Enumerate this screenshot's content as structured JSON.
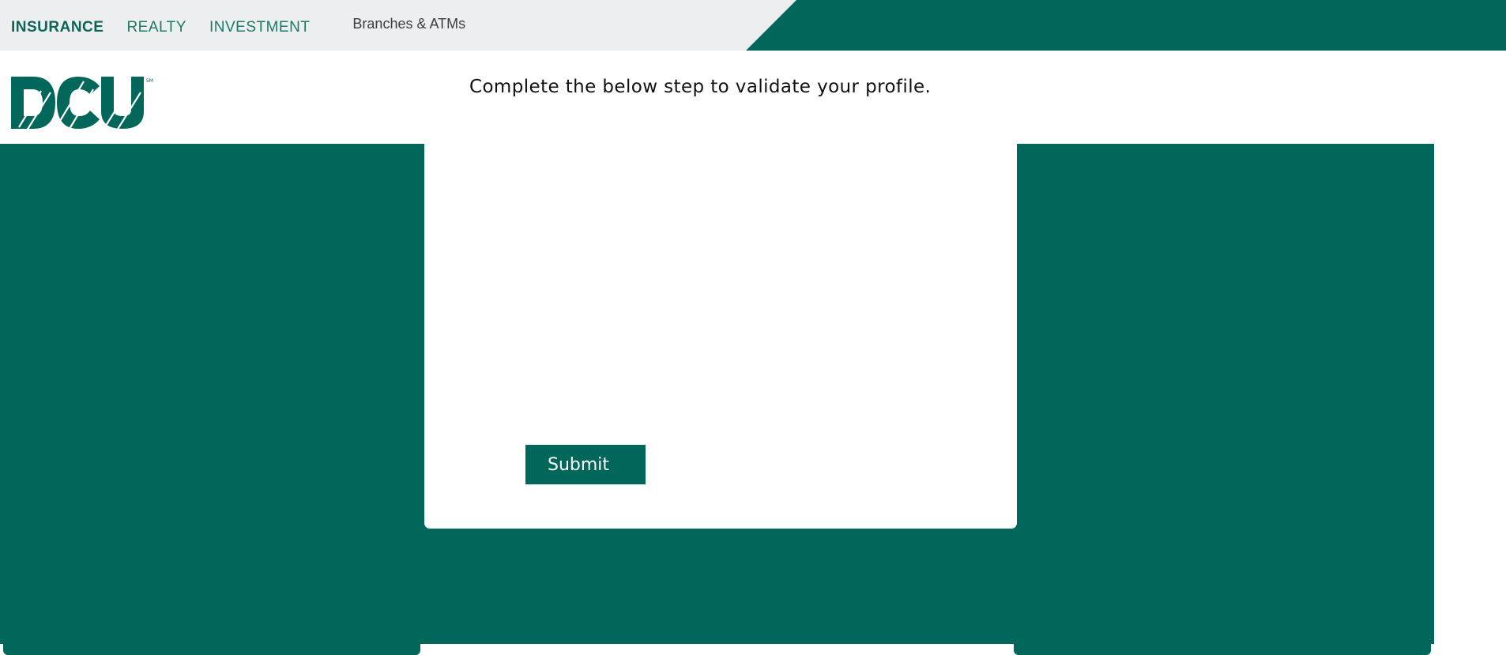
{
  "topnav": {
    "items": [
      {
        "label": "INSURANCE",
        "active": true
      },
      {
        "label": "REALTY",
        "active": false
      },
      {
        "label": "INVESTMENT",
        "active": false
      }
    ],
    "branches_label": "Branches & ATMs"
  },
  "logo": {
    "text": "DCU",
    "mark": "SM"
  },
  "main": {
    "heading": "Complete the below step to validate your profile.",
    "submit_label": "Submit"
  },
  "colors": {
    "brand_green": "#02675b",
    "topbar_gray": "#eceeef",
    "nav_text": "#1d7a68"
  }
}
